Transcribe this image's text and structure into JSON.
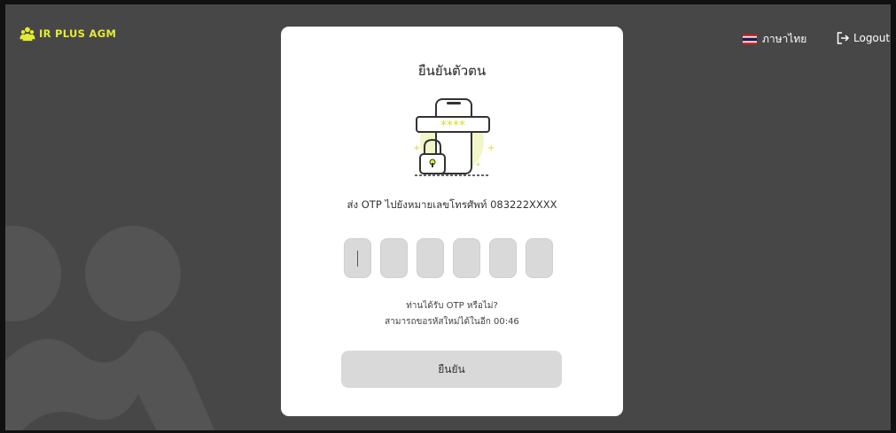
{
  "header": {
    "brand_name": "IR PLUS AGM",
    "brand_icon": "people-group-icon",
    "brand_color": "#e3ec32",
    "language_label": "ภาษาไทย",
    "language_flag": "thai-flag-icon",
    "logout_label": "Logout",
    "logout_icon": "logout-icon"
  },
  "card": {
    "title": "ยืนยันตัวตน",
    "illustration": "phone-password-lock-icon",
    "otp_message": "ส่ง OTP ไปยังหมายเลขโทรศัพท์ 083222XXXX",
    "otp_digits": [
      "",
      "",
      "",
      "",
      "",
      ""
    ],
    "resend_question": "ท่านได้รับ OTP หรือไม่?",
    "resend_countdown": "สามารถขอรหัสใหม่ได้ในอีก 00:46",
    "confirm_label": "ยืนยัน"
  },
  "colors": {
    "background": "#474747",
    "card": "#ffffff",
    "input": "#d9d9d9"
  }
}
